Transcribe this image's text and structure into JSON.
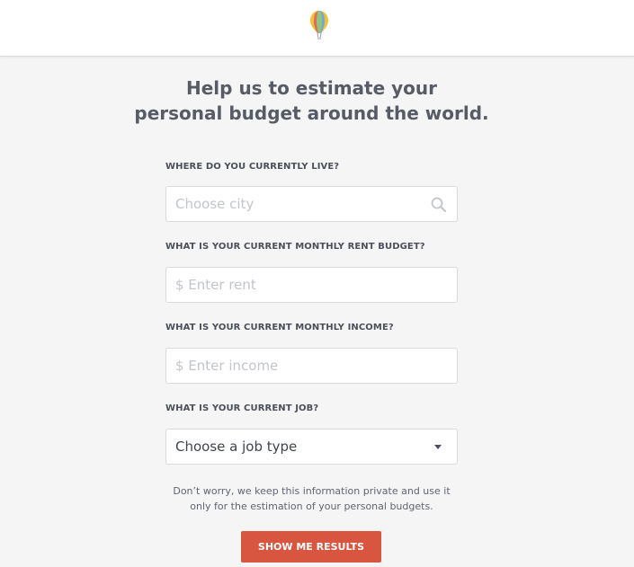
{
  "header": {
    "logo_icon": "hot-air-balloon-icon"
  },
  "headline": {
    "line1": "Help us to estimate your",
    "line2": "personal budget around the world."
  },
  "form": {
    "city": {
      "label": "WHERE DO YOU CURRENTLY LIVE?",
      "placeholder": "Choose city",
      "icon": "search-icon"
    },
    "rent": {
      "label": "WHAT IS YOUR CURRENT MONTHLY RENT BUDGET?",
      "placeholder": "$ Enter rent"
    },
    "income": {
      "label": "WHAT IS YOUR CURRENT MONTHLY INCOME?",
      "placeholder": "$ Enter income"
    },
    "job": {
      "label": "WHAT IS YOUR CURRENT JOB?",
      "selected": "Choose a job type",
      "icon": "caret-down-icon"
    }
  },
  "note": {
    "line1": "Don’t worry, we keep this information private and use it",
    "line2": "only for the estimation of your personal budgets."
  },
  "cta": {
    "label": "SHOW ME RESULTS",
    "color": "#d8553f"
  }
}
